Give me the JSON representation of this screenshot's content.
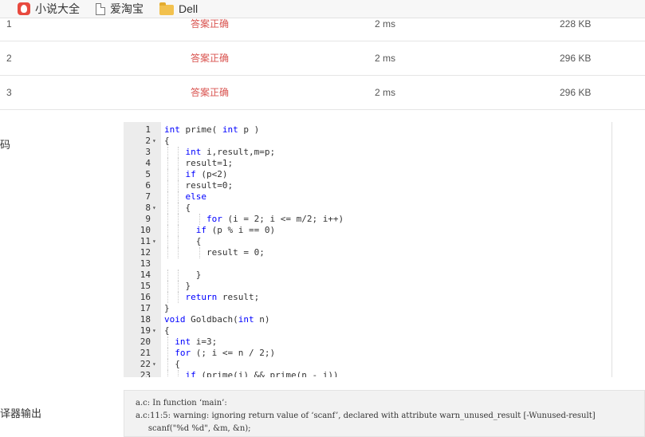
{
  "bookmarks": [
    {
      "label": "小说大全",
      "icon": "novel-icon"
    },
    {
      "label": "爱淘宝",
      "icon": "page-icon"
    },
    {
      "label": "Dell",
      "icon": "folder-icon"
    }
  ],
  "results": [
    {
      "num": "1",
      "status": "答案正确",
      "time": "2 ms",
      "memory": "228 KB"
    },
    {
      "num": "2",
      "status": "答案正确",
      "time": "2 ms",
      "memory": "296 KB"
    },
    {
      "num": "3",
      "status": "答案正确",
      "time": "2 ms",
      "memory": "296 KB"
    }
  ],
  "labels": {
    "code": "代码",
    "compiler": "编译器输出"
  },
  "code": {
    "lines": [
      {
        "n": "1",
        "text": "int prime( int p )"
      },
      {
        "n": "2",
        "text": "{"
      },
      {
        "n": "3",
        "text": "    int i,result,m=p;"
      },
      {
        "n": "4",
        "text": "    result=1;"
      },
      {
        "n": "5",
        "text": "    if (p<2)"
      },
      {
        "n": "6",
        "text": "    result=0;"
      },
      {
        "n": "7",
        "text": "    else"
      },
      {
        "n": "8",
        "text": "    {"
      },
      {
        "n": "9",
        "text": "        for (i = 2; i <= m/2; i++)"
      },
      {
        "n": "10",
        "text": "      if (p % i == 0)"
      },
      {
        "n": "11",
        "text": "      {"
      },
      {
        "n": "12",
        "text": "        result = 0;"
      },
      {
        "n": "13",
        "text": ""
      },
      {
        "n": "14",
        "text": "      }"
      },
      {
        "n": "15",
        "text": "    }"
      },
      {
        "n": "16",
        "text": "    return result;"
      },
      {
        "n": "17",
        "text": "}"
      },
      {
        "n": "18",
        "text": "void Goldbach(int n)"
      },
      {
        "n": "19",
        "text": "{"
      },
      {
        "n": "20",
        "text": "  int i=3;"
      },
      {
        "n": "21",
        "text": "  for (; i <= n / 2;)"
      },
      {
        "n": "22",
        "text": "  {"
      },
      {
        "n": "23",
        "text": "    if (prime(i) && prime(n - i))"
      }
    ],
    "folds": [
      "2",
      "8",
      "11",
      "19",
      "22"
    ]
  },
  "compiler_output": [
    "a.c: In function ‘main’:",
    "a.c:11:5: warning: ignoring return value of ‘scanf’, declared with attribute warn_unused_result [-Wunused-result]",
    "     scanf(\"%d %d\", &m, &n);"
  ],
  "colors": {
    "status_ok": "#d9534f",
    "keyword": "#0000ff"
  }
}
